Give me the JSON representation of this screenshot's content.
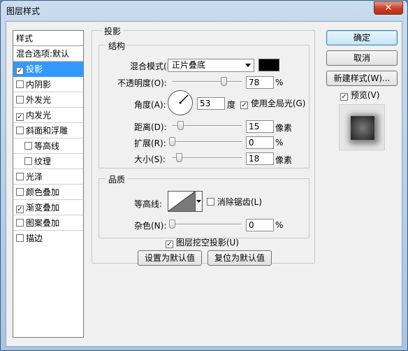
{
  "window": {
    "title": "图层样式",
    "close": "✕"
  },
  "sidebar": {
    "header": "样式",
    "items": [
      {
        "label": "混合选项:默认",
        "check": false,
        "has_check": false
      },
      {
        "label": "投影",
        "check": true,
        "has_check": true,
        "selected": true
      },
      {
        "label": "内阴影",
        "check": false,
        "has_check": true
      },
      {
        "label": "外发光",
        "check": false,
        "has_check": true
      },
      {
        "label": "内发光",
        "check": true,
        "has_check": true
      },
      {
        "label": "斜面和浮雕",
        "check": false,
        "has_check": true
      },
      {
        "label": "等高线",
        "check": false,
        "has_check": true,
        "sub": true
      },
      {
        "label": "纹理",
        "check": false,
        "has_check": true,
        "sub": true
      },
      {
        "label": "光泽",
        "check": false,
        "has_check": true
      },
      {
        "label": "颜色叠加",
        "check": false,
        "has_check": true
      },
      {
        "label": "渐变叠加",
        "check": true,
        "has_check": true
      },
      {
        "label": "图案叠加",
        "check": false,
        "has_check": true
      },
      {
        "label": "描边",
        "check": false,
        "has_check": true
      }
    ]
  },
  "drop_shadow": {
    "title": "投影",
    "structure": {
      "title": "结构",
      "blend_mode_label": "混合模式(B):",
      "blend_mode_value": "正片叠底",
      "shadow_color": "#000000",
      "opacity_label": "不透明度(O):",
      "opacity_value": "78",
      "opacity_unit": "%",
      "opacity_level": 0.78,
      "angle_label": "角度(A):",
      "angle_value": "53",
      "angle_unit": "度",
      "global_light_label": "使用全局光(G)",
      "global_light": true,
      "distance_label": "距离(D):",
      "distance_value": "15",
      "distance_unit": "像素",
      "spread_label": "扩展(R):",
      "spread_value": "0",
      "spread_unit": "%",
      "size_label": "大小(S):",
      "size_value": "18",
      "size_unit": "像素"
    },
    "quality": {
      "title": "品质",
      "contour_label": "等高线:",
      "anti_alias_label": "消除锯齿(L)",
      "anti_alias": false,
      "noise_label": "杂色(N):",
      "noise_value": "0",
      "noise_unit": "%"
    },
    "knockout_label": "图层挖空投影(U)",
    "knockout": true,
    "make_default": "设置为默认值",
    "reset_default": "复位为默认值"
  },
  "actions": {
    "ok": "确定",
    "cancel": "取消",
    "new_style": "新建样式(W)...",
    "preview_label": "预览(V)",
    "preview": true
  },
  "icons": {
    "check": "✓"
  }
}
